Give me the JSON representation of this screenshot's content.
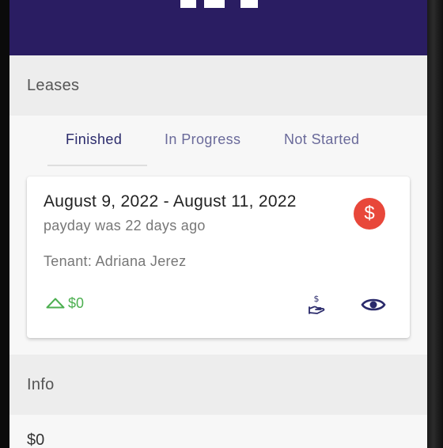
{
  "sections": {
    "leases_title": "Leases",
    "info_title": "Info"
  },
  "tabs": [
    {
      "label": "Finished",
      "active": true
    },
    {
      "label": "In Progress",
      "active": false
    },
    {
      "label": "Not Started",
      "active": false
    }
  ],
  "lease_card": {
    "date_range": "August 9, 2022 - August 11, 2022",
    "payday_text": "payday was 22 days ago",
    "tenant_text": "Tenant: Adriana Jerez",
    "status_symbol": "$",
    "status_icon": "dollar-circle-icon",
    "balance": "$0",
    "balance_icon": "triangle-up-icon",
    "action_icons": [
      "hand-coin-icon",
      "eye-icon"
    ]
  },
  "info": {
    "value": "$0"
  },
  "colors": {
    "header_bg": "#2a1d62",
    "status_red": "#e8473a",
    "balance_green": "#4caf50",
    "tab_active": "#2a2a6b",
    "icon_dark": "#2a2a6b"
  }
}
